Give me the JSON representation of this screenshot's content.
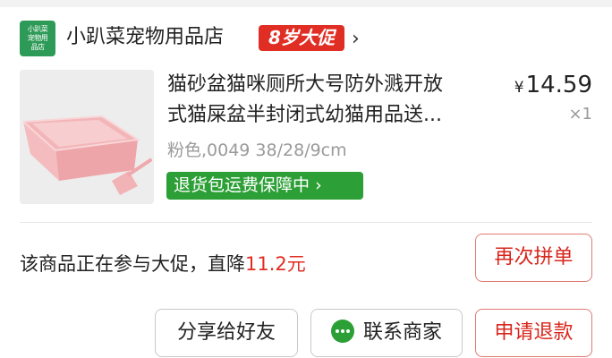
{
  "shop": {
    "logo_lines": [
      "小趴菜",
      "宠物用",
      "品店"
    ],
    "name": "小趴菜宠物用品店",
    "badge": "8岁大促",
    "chevron": "›"
  },
  "product": {
    "title_line1": "猫砂盆猫咪厕所大号防外溅开放",
    "title_line2": "式猫屎盆半封闭式幼猫用品送...",
    "currency": "¥",
    "price": "14.59",
    "quantity": "×1",
    "spec": "粉色,0049 38/28/9cm",
    "guarantee": "退货包运费保障中",
    "guarantee_chevron": "›",
    "image_icon": "pink-litter-box-with-scoop"
  },
  "promo": {
    "text": "该商品正在参与大促，直降",
    "amount": "11.2元"
  },
  "buttons": {
    "rebuy": "再次拼单",
    "share": "分享给好友",
    "contact": "联系商家",
    "refund": "申请退款"
  },
  "colors": {
    "accent_red": "#e02e24",
    "green": "#2c9f36"
  }
}
